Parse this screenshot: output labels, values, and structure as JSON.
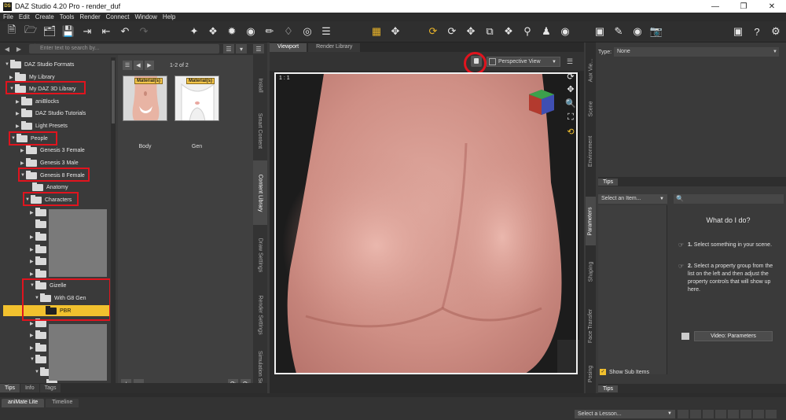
{
  "window": {
    "title": "DAZ Studio 4.20 Pro - render_duf",
    "app_icon_text": "DS"
  },
  "menu": [
    "File",
    "Edit",
    "Create",
    "Tools",
    "Render",
    "Connect",
    "Window",
    "Help"
  ],
  "content_library": {
    "search_placeholder": "Enter text to search by...",
    "pager": "1-2 of 2",
    "tree": [
      {
        "label": "DAZ Studio Formats",
        "expanded": true
      },
      {
        "label": "My Library",
        "expanded": false
      },
      {
        "label": "My DAZ 3D Library",
        "expanded": true,
        "highlighted": true
      },
      {
        "label": "aniBlocks",
        "expanded": false
      },
      {
        "label": "DAZ Studio Tutorials",
        "expanded": false
      },
      {
        "label": "Light Presets",
        "expanded": false
      },
      {
        "label": "People",
        "expanded": true,
        "highlighted": true
      },
      {
        "label": "Genesis 3 Female",
        "expanded": false
      },
      {
        "label": "Genesis 3 Male",
        "expanded": false
      },
      {
        "label": "Genesis 8 Female",
        "expanded": true,
        "highlighted": true
      },
      {
        "label": "Anatomy",
        "expanded": false
      },
      {
        "label": "Characters",
        "expanded": true,
        "highlighted": true
      },
      {
        "label": "Gizelle",
        "expanded": true,
        "highlighted": true
      },
      {
        "label": "With G8 Gen",
        "expanded": true
      },
      {
        "label": "PBR",
        "selected": true
      }
    ],
    "thumbnails": [
      {
        "name": "Body",
        "badge": "Material(s)"
      },
      {
        "name": "Gen",
        "badge": "Material(s)"
      }
    ],
    "side_tabs": [
      "Install",
      "Smart Content",
      "Content Library",
      "Draw Settings",
      "Render Settings",
      "Simulation Se..."
    ],
    "bottom_tabs": [
      "Tips",
      "Info",
      "Tags"
    ]
  },
  "viewport": {
    "tabs": [
      "Viewport",
      "Render Library"
    ],
    "camera": "Perspective View",
    "frame_label": "1 : 1"
  },
  "right_panel": {
    "type_label": "Type:",
    "type_value": "None",
    "tips_label": "Tips",
    "select_item": "Select an Item...",
    "help_title": "What do I do?",
    "steps": [
      {
        "num": "1.",
        "text": "Select something in your scene."
      },
      {
        "num": "2.",
        "text": "Select a property group from the list on the left and then adjust the property controls that will show up here."
      }
    ],
    "video_button": "Video: Parameters",
    "show_sub_items": "Show Sub Items",
    "side_tabs_top": [
      "Aux Vie...",
      "Scene",
      "Environment"
    ],
    "side_tabs_bottom": [
      "Parameters",
      "Shaping",
      "Face Transfer",
      "Posing"
    ],
    "bottom_tips": "Tips"
  },
  "animate": {
    "tabs": [
      "aniMate Lite",
      "Timeline"
    ],
    "lesson_select": "Select a Lesson..."
  },
  "colors": {
    "accent": "#f2c12e",
    "annotation": "#e0141e",
    "panel": "#3a3a3a"
  }
}
